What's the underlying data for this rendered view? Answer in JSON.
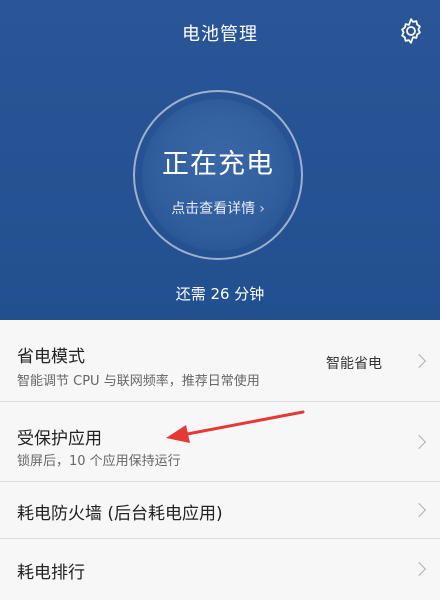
{
  "header": {
    "title": "电池管理",
    "settings_icon": "gear-icon",
    "status": "正在充电",
    "details_link": "点击查看详情",
    "details_chevron": "›",
    "remaining": "还需 26 分钟"
  },
  "colors": {
    "header_bg": "#2a5597",
    "annotation_arrow": "#e53935"
  },
  "items": [
    {
      "title": "省电模式",
      "subtitle": "智能调节 CPU 与联网频率，推荐日常使用",
      "value": "智能省电"
    },
    {
      "title": "受保护应用",
      "subtitle": "锁屏后，10 个应用保持运行"
    },
    {
      "title": "耗电防火墙 (后台耗电应用)"
    },
    {
      "title": "耗电排行"
    }
  ]
}
